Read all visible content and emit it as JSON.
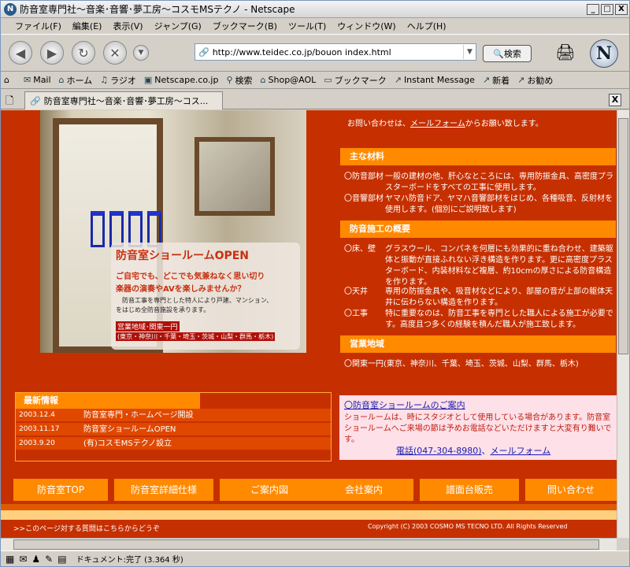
{
  "window": {
    "title": "防音室専門社～音楽･音響･夢工房～コスモMSテクノ - Netscape",
    "minimize": "_",
    "maximize": "□",
    "close": "X"
  },
  "menu": [
    "ファイル(F)",
    "編集(E)",
    "表示(V)",
    "ジャンプ(G)",
    "ブックマーク(B)",
    "ツール(T)",
    "ウィンドウ(W)",
    "ヘルプ(H)"
  ],
  "navigation": {
    "url": "http://www.teidec.co.jp/bouon index.html",
    "search_label": "検索"
  },
  "personal_toolbar": [
    "Mail",
    "ホーム",
    "ラジオ",
    "Netscape.co.jp",
    "検索",
    "Shop@AOL",
    "ブックマーク",
    "Instant Message",
    "新着",
    "お勧め"
  ],
  "tab": {
    "label": "防音室専門社～音楽･音響･夢工房～コス...",
    "close": "X"
  },
  "promo": {
    "title": "防音室ショールームOPEN",
    "line1": "ご自宅でも、どこでも気兼ねなく思い切り",
    "line2": "楽器の演奏やAVを楽しみませんか？",
    "line3": "防音工事を専門とした特人により戸建、マンション、",
    "line4": "をはじめ全防音施設を承ります。",
    "area_title": "営業地域･関東一円",
    "areas": "(東京・神奈川・千葉・埼玉・茨城・山梨・群馬・栃木)"
  },
  "contact_top": {
    "prefix": "お問い合わせは、",
    "link": "メールフォーム",
    "suffix": "からお願い致します。"
  },
  "sections": {
    "materials": {
      "title": "主な材料",
      "items": [
        {
          "key": "〇防音部材",
          "value": "一般の建材の他、肝心なところには、専用防振金具、高密度プラスターボードをすべての工事に使用します。"
        },
        {
          "key": "〇音響部材",
          "value": "ヤマハ防音ドア、ヤマハ音響部材をはじめ、各種吸音、反射材を使用します。(個別にご説明致します)"
        }
      ]
    },
    "construction": {
      "title": "防音施工の概要",
      "items": [
        {
          "key": "〇床、壁",
          "value": "グラスウール、コンパネを何層にも効果的に重ね合わせ、建築躯体と振動が直接ふれない浮き構造を作ります。更に高密度プラスターボード、内装材料など複層、約10cmの厚さによる防音構造を作ります。"
        },
        {
          "key": "〇天井",
          "value": "専用の防振金具や、吸音材などにより、部屋の音が上部の躯体天井に伝わらない構造を作ります。"
        },
        {
          "key": "〇工事",
          "value": "特に重要なのは、防音工事を専門とした職人による施工が必要です。高度且つ多くの経験を積んだ職人が施工致します。"
        }
      ]
    },
    "area": {
      "title": "営業地域",
      "text": "〇関東一円(東京、神奈川、千葉、埼玉、茨城、山梨、群馬、栃木)"
    }
  },
  "news": {
    "title": "最新情報",
    "rows": [
      {
        "date": "2003.12.4",
        "text": "防音室専門・ホームページ開設"
      },
      {
        "date": "2003.11.17",
        "text": "防音室ショールームOPEN"
      },
      {
        "date": "2003.9.20",
        "text": "(有)コスモMSテクノ設立"
      }
    ]
  },
  "showroom": {
    "title": "〇防音室ショールームのご案内",
    "body": "ショールームは、時にスタジオとして使用している場合があります。防音室ショールームへご来場の節は予めお電話などいただけますと大変有り難いです。",
    "phone": "電話(047-304-8980)",
    "sep": "、",
    "mail": "メールフォーム"
  },
  "nav_buttons": [
    "防音室TOP",
    "防音室詳細仕様",
    "ご案内図",
    "会社案内",
    "譜面台販売",
    "問い合わせ"
  ],
  "footer": {
    "left": ">>このページ対する質問はこちらからどうぞ",
    "right": "Copyright (C) 2003 COSMO MS TECNO LTD. All Rights Reserved"
  },
  "status": {
    "text": "ドキュメント:完了 (3.364 秒)"
  },
  "colors": {
    "page_bg": "#c63000",
    "accent_orange": "#ff8a00",
    "link_blue": "#1a1ab0",
    "showroom_bg": "#fde0e8"
  }
}
